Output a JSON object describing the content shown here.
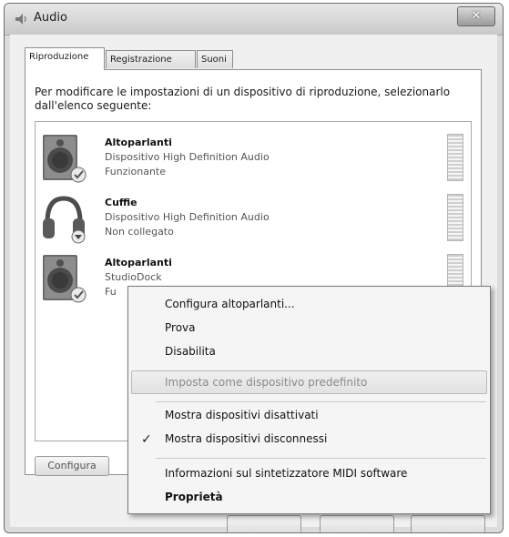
{
  "window": {
    "title": "Audio",
    "close": "✕"
  },
  "tabs": [
    "Riproduzione",
    "Registrazione",
    "Suoni"
  ],
  "description": "Per modificare le impostazioni di un dispositivo di riproduzione, selezionarlo dall'elenco seguente:",
  "devices": [
    {
      "name": "Altoparlanti",
      "line1": "Dispositivo High Definition Audio",
      "line2": "Funzionante",
      "icon": "speaker-icon",
      "status_icon": "check-badge-icon"
    },
    {
      "name": "Cuffie",
      "line1": "Dispositivo High Definition Audio",
      "line2": "Non collegato",
      "icon": "headphones-icon",
      "status_icon": "down-arrow-badge-icon"
    },
    {
      "name": "Altoparlanti",
      "line1": "StudioDock",
      "line2": "Fu",
      "icon": "speaker-icon",
      "status_icon": "check-badge-icon"
    }
  ],
  "buttons": {
    "configure": "Configura"
  },
  "context_menu": {
    "items": [
      {
        "label": "Configura altoparlanti..."
      },
      {
        "label": "Prova"
      },
      {
        "label": "Disabilita"
      },
      {
        "label": "Imposta come dispositivo predefinito",
        "state": "disabled"
      },
      {
        "label": "Mostra dispositivi disattivati"
      },
      {
        "label": "Mostra dispositivi disconnessi",
        "checked": true
      },
      {
        "label": "Informazioni sul sintetizzatore MIDI software"
      },
      {
        "label": "Proprietà",
        "bold": true
      }
    ],
    "check_mark": "✓"
  }
}
